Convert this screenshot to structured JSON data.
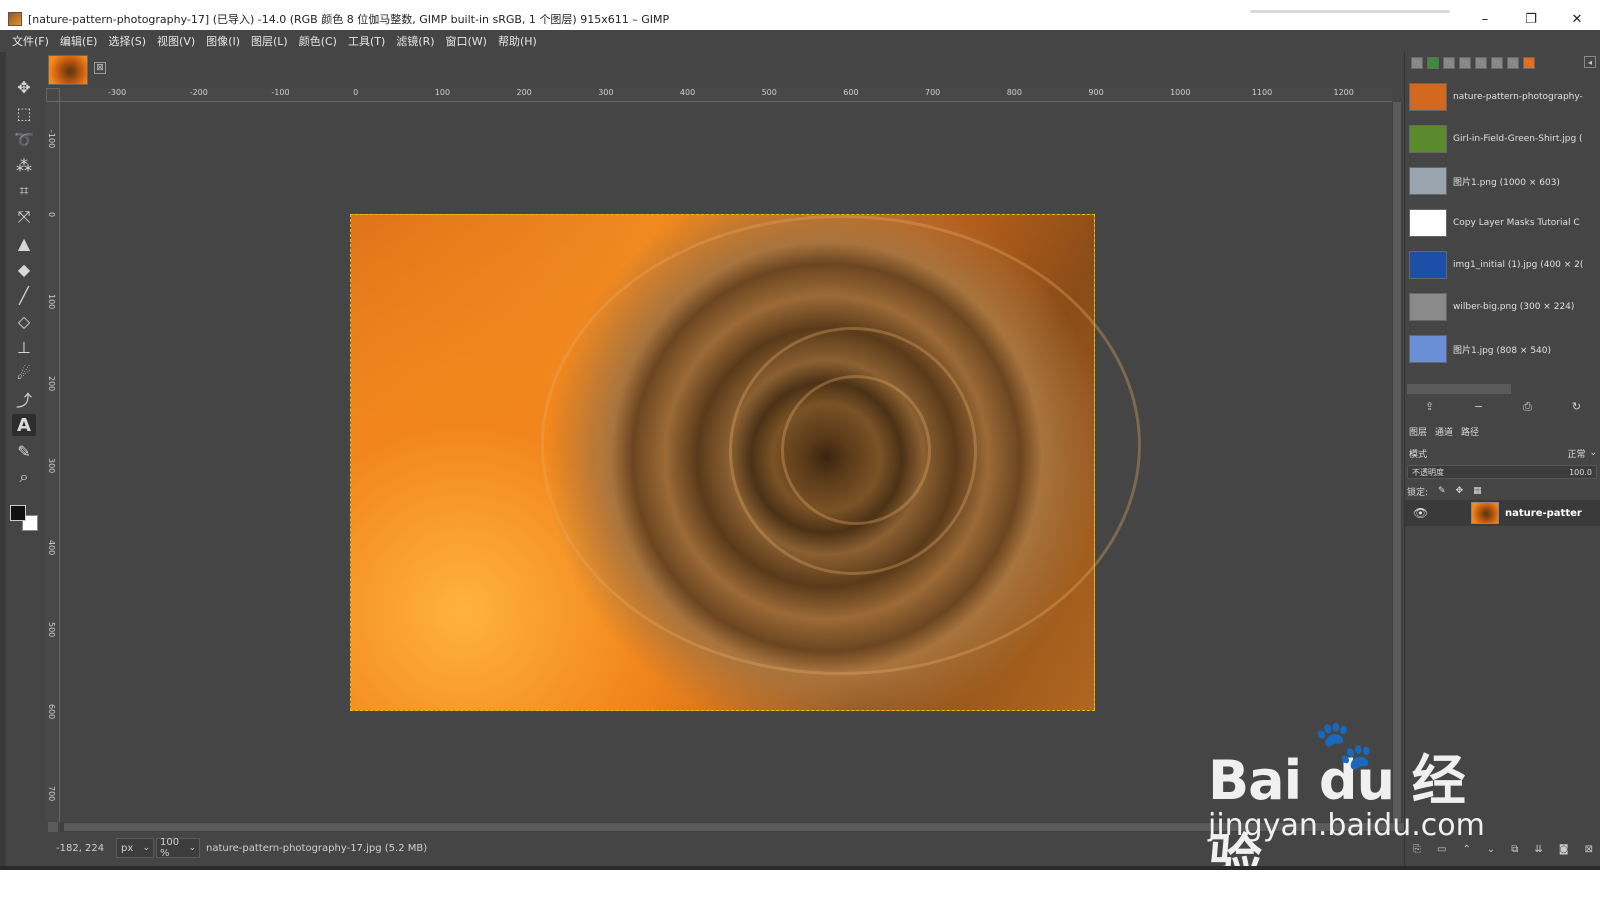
{
  "window": {
    "title": "[nature-pattern-photography-17] (已导入) -14.0 (RGB 颜色 8 位伽马整数, GIMP built-in sRGB, 1 个图层) 915x611 – GIMP",
    "minimize": "–",
    "maximize": "❐",
    "close": "✕"
  },
  "menubar": {
    "items": [
      "文件(F)",
      "编辑(E)",
      "选择(S)",
      "视图(V)",
      "图像(I)",
      "图层(L)",
      "颜色(C)",
      "工具(T)",
      "滤镜(R)",
      "窗口(W)",
      "帮助(H)"
    ]
  },
  "toolbox": {
    "tools": [
      {
        "name": "move-tool-icon",
        "glyph": "✥"
      },
      {
        "name": "rect-select-icon",
        "glyph": "⬚"
      },
      {
        "name": "lasso-icon",
        "glyph": "➰"
      },
      {
        "name": "fuzzy-select-icon",
        "glyph": "⁂"
      },
      {
        "name": "crop-icon",
        "glyph": "⌗"
      },
      {
        "name": "unified-transform-icon",
        "glyph": "⤧"
      },
      {
        "name": "warp-icon",
        "glyph": "▲"
      },
      {
        "name": "bucket-fill-icon",
        "glyph": "◆"
      },
      {
        "name": "paintbrush-icon",
        "glyph": "╱"
      },
      {
        "name": "eraser-icon",
        "glyph": "◇"
      },
      {
        "name": "clone-icon",
        "glyph": "⊥"
      },
      {
        "name": "smudge-icon",
        "glyph": "☄"
      },
      {
        "name": "paths-icon",
        "glyph": "⤴"
      },
      {
        "name": "text-tool-icon",
        "glyph": "A"
      },
      {
        "name": "color-picker-icon",
        "glyph": "✎"
      },
      {
        "name": "zoom-icon",
        "glyph": "⌕"
      }
    ]
  },
  "image_tab": {
    "close": "⊠"
  },
  "ruler": {
    "h_ticks": [
      "-300",
      "-200",
      "-100",
      "0",
      "100",
      "200",
      "300",
      "400",
      "500",
      "600",
      "700",
      "800",
      "900",
      "1000",
      "1100",
      "1200"
    ],
    "v_ticks": [
      "-100",
      "0",
      "100",
      "200",
      "300",
      "400",
      "500",
      "600",
      "700"
    ]
  },
  "statusbar": {
    "coords": "-182, 224",
    "unit": "px",
    "zoom": "100 %",
    "file_info": "nature-pattern-photography-17.jpg (5.2 MB)"
  },
  "images_panel": {
    "items": [
      {
        "name": "nature-pattern-photography-",
        "thumb_color": "#d2691e"
      },
      {
        "name": "Girl-in-Field-Green-Shirt.jpg (",
        "thumb_color": "#5a8a2e"
      },
      {
        "name": "图片1.png (1000 × 603)",
        "thumb_color": "#9aa4ae"
      },
      {
        "name": "Copy Layer Masks Tutorial C",
        "thumb_color": "#ffffff"
      },
      {
        "name": "img1_initial (1).jpg (400 × 2(",
        "thumb_color": "#1e4fa8"
      },
      {
        "name": "wilber-big.png (300 × 224)",
        "thumb_color": "#8a8a8a"
      },
      {
        "name": "图片1.jpg (808 × 540)",
        "thumb_color": "#6a8fd8"
      }
    ]
  },
  "layers_panel": {
    "tabs": [
      "图层",
      "通道",
      "路径"
    ],
    "mode_label": "模式",
    "mode_value": "正常",
    "opacity_label": "不透明度",
    "opacity_value": "100.0",
    "lock_label": "锁定:",
    "layer_name": "nature-patter"
  },
  "watermark": {
    "logo": "Bai  du 经验",
    "url": "jingyan.baidu.com"
  },
  "colors": {
    "ui_bg": "#454545",
    "fg": "#111111",
    "bg": "#ffffff"
  }
}
